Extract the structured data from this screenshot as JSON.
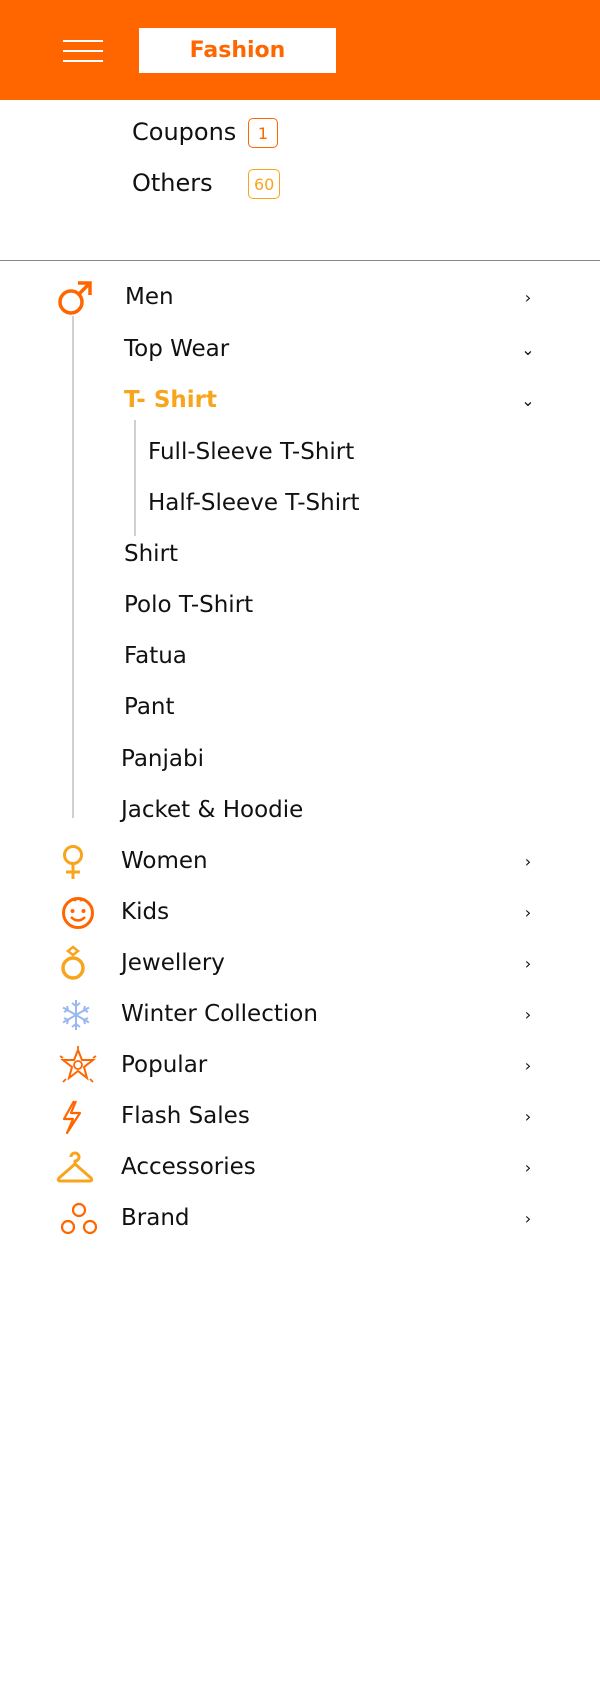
{
  "header": {
    "logo_text": "Fashion",
    "bg_color": "#ff6600"
  },
  "extras": [
    {
      "label": "Coupons",
      "count": "1",
      "badge_color": "#ff6600"
    },
    {
      "label": "Others",
      "count": "60",
      "badge_color": "#f7a51c"
    }
  ],
  "menu": {
    "men": {
      "label": "Men",
      "icon": "male-icon",
      "children": {
        "top_wear": "Top Wear",
        "t_shirt": "T- Shirt",
        "t_shirt_children": [
          "Full-Sleeve T-Shirt",
          "Half-Sleeve T-Shirt"
        ],
        "others": [
          "Shirt",
          "Polo T-Shirt",
          "Fatua",
          "Pant",
          "Panjabi",
          "Jacket & Hoodie"
        ]
      }
    },
    "categories": [
      {
        "label": "Women",
        "icon": "female-icon"
      },
      {
        "label": "Kids",
        "icon": "kid-face-icon"
      },
      {
        "label": "Jewellery",
        "icon": "ring-icon"
      },
      {
        "label": "Winter Collection",
        "icon": "snowflake-icon"
      },
      {
        "label": "Popular",
        "icon": "badge-star-icon"
      },
      {
        "label": "Flash Sales",
        "icon": "lightning-icon"
      },
      {
        "label": "Accessories",
        "icon": "hanger-icon"
      },
      {
        "label": "Brand",
        "icon": "brand-circles-icon"
      }
    ]
  },
  "colors": {
    "accent": "#ff6600",
    "active": "#f7a51c",
    "snow": "#9ab8ee"
  }
}
